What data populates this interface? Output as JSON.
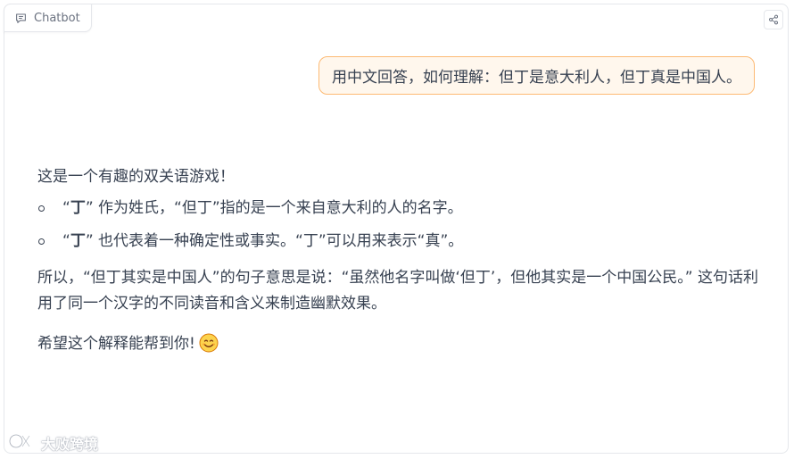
{
  "header": {
    "tab_label": "Chatbot"
  },
  "conversation": {
    "user_message": "用中文回答，如何理解：但丁是意大利人，但丁真是中国人。",
    "bot": {
      "intro": "这是一个有趣的双关语游戏！",
      "bullets": [
        {
          "open_quote": "“",
          "bold": "丁",
          "close_quote": "”",
          "rest": " 作为姓氏，“但丁”指的是一个来自意大利的人的名字。"
        },
        {
          "open_quote": "“",
          "bold": "丁",
          "close_quote": "”",
          "rest": " 也代表着一种确定性或事实。“丁”可以用来表示“真”。"
        }
      ],
      "explanation": "所以，“但丁其实是中国人”的句子意思是说：“虽然他名字叫做‘但丁’，但他其实是一个中国公民。” 这句话利用了同一个汉字的不同读音和含义来制造幽默效果。",
      "closing": "希望这个解释能帮到你!"
    }
  },
  "watermark": {
    "text": "大败跨境"
  },
  "colors": {
    "user_bubble_bg": "#fff7ed",
    "user_bubble_border": "#fdba74",
    "text": "#374151",
    "muted": "#6b7280"
  },
  "icons": {
    "tab": "chat-bubble-icon",
    "share": "share-icon",
    "emoji": "smiling-face-icon",
    "watermark": "watermark-logo-icon"
  }
}
